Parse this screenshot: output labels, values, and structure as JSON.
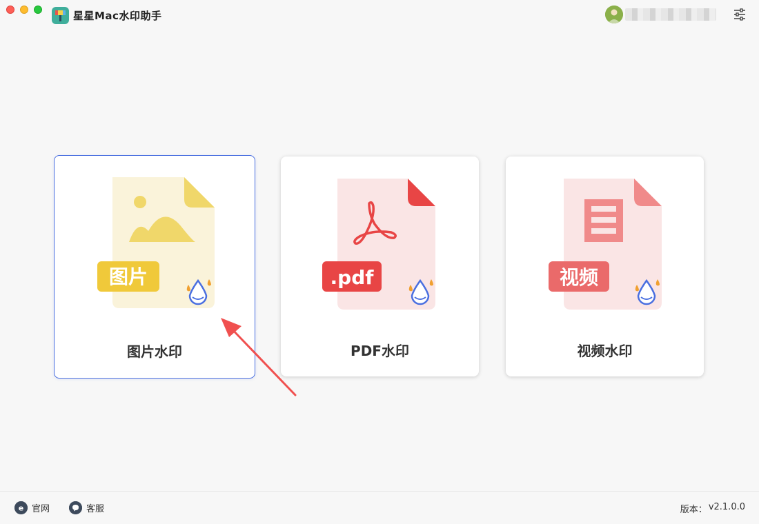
{
  "window": {
    "title": "星星Mac水印助手"
  },
  "account": {
    "avatar_icon": "user-avatar-icon",
    "username": "",
    "settings_icon": "settings-sliders-icon"
  },
  "cards": [
    {
      "id": "image",
      "label": "图片水印",
      "badge": "图片",
      "color": "#f0c93a",
      "selected": true
    },
    {
      "id": "pdf",
      "label": "PDF水印",
      "badge": ".pdf",
      "color": "#e84545",
      "selected": false
    },
    {
      "id": "video",
      "label": "视频水印",
      "badge": "视频",
      "color": "#ea6a6a",
      "selected": false
    }
  ],
  "footer": {
    "site_label": "官网",
    "service_label": "客服",
    "version_label": "版本：",
    "version_value": "v2.1.0.0"
  },
  "colors": {
    "accent": "#4a6fe0",
    "arrow": "#f0504f",
    "image_yellow": "#f0c93a",
    "pdf_red": "#e84545",
    "video_red": "#ea6a6a"
  }
}
